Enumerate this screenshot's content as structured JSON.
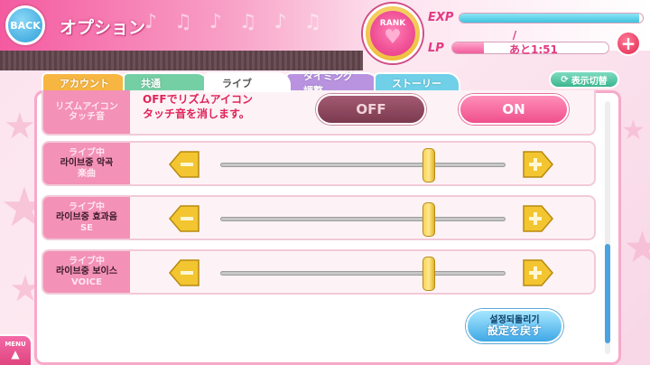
{
  "header": {
    "back_label": "BACK",
    "title": "オプション",
    "rank_label": "RANK",
    "exp_label": "EXP",
    "exp_progress": 0.98,
    "lp_label": "LP",
    "lp_value": "/",
    "lp_progress": 0.2,
    "lp_timer": "あと1:51",
    "plus_label": "+"
  },
  "tabs": [
    {
      "label": "アカウント",
      "selected": false
    },
    {
      "label": "共通",
      "selected": false
    },
    {
      "label": "ライブ",
      "selected": true
    },
    {
      "label": "タイミング調整",
      "selected": false
    },
    {
      "label": "ストーリー",
      "selected": false
    }
  ],
  "display_switch_label": "表示切替",
  "rows": {
    "rhythm_icon": {
      "label_line1": "リズムアイコン",
      "label_line2": "タッチ音",
      "description_line1": "OFFでリズムアイコン",
      "description_line2": "タッチ音を消します。",
      "off_label": "OFF",
      "on_label": "ON",
      "selected": "ON"
    },
    "music": {
      "label_ja": "ライブ中",
      "label_ko": "라이브중 악곡",
      "label_en": "楽曲",
      "volume_fraction": 0.73
    },
    "se": {
      "label_ja": "ライブ中",
      "label_ko": "라이브중 효과음",
      "label_en": "SE",
      "volume_fraction": 0.73
    },
    "voice": {
      "label_ja": "ライブ中",
      "label_ko": "라이브중 보이스",
      "label_en": "VOICE",
      "volume_fraction": 0.73
    }
  },
  "reset": {
    "label_ko": "설정되돌리기",
    "label_ja": "設定を戻す"
  },
  "menu_label": "MENU",
  "colors": {
    "brand_pink": "#f45aa0",
    "accent_blue": "#4aa2e0",
    "slider_gold": "#f6d25a"
  }
}
